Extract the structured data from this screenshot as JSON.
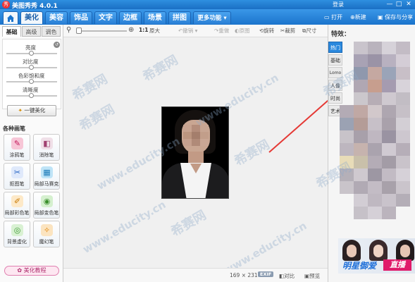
{
  "window": {
    "app_title": "美图秀秀 4.0.1",
    "login_label": "登录",
    "logo_char": "秀",
    "minimize_glyph": "—",
    "maximize_glyph": "□",
    "close_glyph": "✕"
  },
  "main_tabs": [
    {
      "label": "美化",
      "active": true
    },
    {
      "label": "美容"
    },
    {
      "label": "饰品"
    },
    {
      "label": "文字"
    },
    {
      "label": "边框"
    },
    {
      "label": "场景"
    },
    {
      "label": "拼图"
    },
    {
      "label": "更多功能 ▾"
    }
  ],
  "top_actions": {
    "open": "打开",
    "new": "新建",
    "save_share": "保存与分享"
  },
  "left_panel": {
    "subtabs": [
      "基础",
      "高级",
      "调色"
    ],
    "sliders": [
      {
        "label": "亮度",
        "value": 0.5
      },
      {
        "label": "对比度",
        "value": 0.5
      },
      {
        "label": "色彩饱和度",
        "value": 0.5
      },
      {
        "label": "清晰度",
        "value": 0.5
      }
    ],
    "auto_beautify": "一键美化",
    "pens_title": "各种画笔",
    "pens": [
      "涂鸦笔",
      "消除笔",
      "抠图笔",
      "局部马赛克",
      "局部彩色笔",
      "局部变色笔",
      "背景虚化",
      "魔幻笔"
    ],
    "help_button": "美化教程"
  },
  "toolbar": {
    "zoom_ratio": "1:1",
    "enlarge": "原大",
    "undo": "撤销",
    "redo": "重做",
    "original": "原图",
    "rotate": "旋转",
    "crop": "裁剪",
    "resize": "尺寸"
  },
  "status_bar": {
    "dimensions": "169 × 231",
    "exif": "EXIF",
    "compare": "对比",
    "preview": "预览"
  },
  "right_panel": {
    "title": "特效：",
    "categories": [
      "热门",
      "基础",
      "Lomo",
      "人像",
      "时尚",
      "艺术"
    ],
    "banner_text_left": "明星御爱",
    "banner_text_right": "直播"
  },
  "watermarks": [
    "希赛网",
    "www.educity.cn"
  ],
  "colors": {
    "accent": "#1b74cc",
    "arrow": "#e53935"
  }
}
